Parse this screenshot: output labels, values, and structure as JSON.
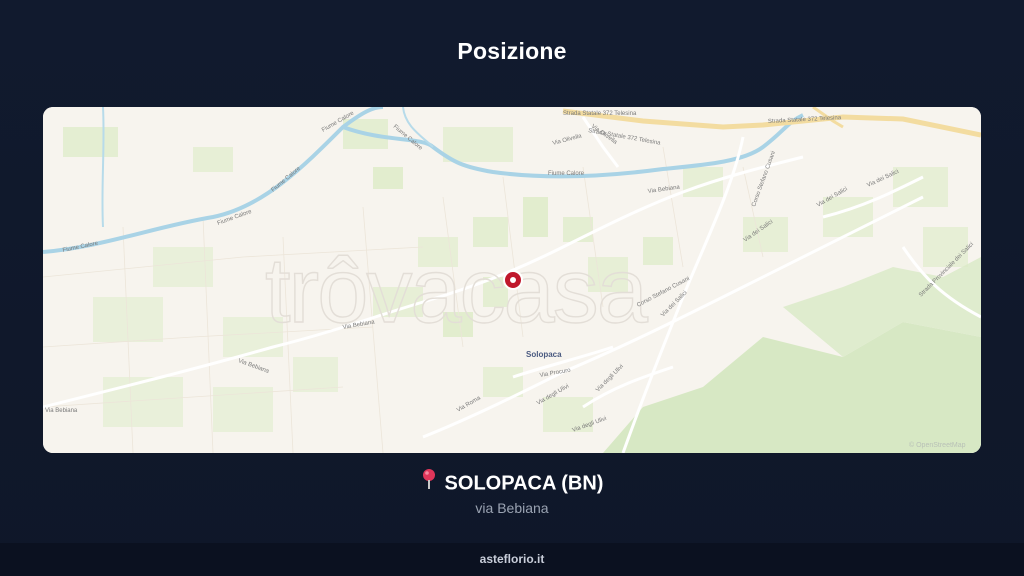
{
  "page": {
    "title": "Posizione"
  },
  "map": {
    "watermark": "trôvacasa",
    "town_label": "Solopaca",
    "attribution": "© OpenStreetMap",
    "marker_icon": "location-marker-icon",
    "road_labels": {
      "via_bebiana_1": "Via Bebiana",
      "via_bebiana_2": "Via Bebiana",
      "via_bebiana_3": "Via Bebiana",
      "via_bebiana_4": "Via Bebiana",
      "via_olivella_1": "Via Olivella",
      "via_olivella_2": "Via Olivella",
      "telesina_1": "Strada Statale 372 Telesina",
      "telesina_2": "Strada Statale 372 Telesina",
      "telesina_3": "Strada Statale 372 Telesina",
      "calore_1": "Fiume Calore",
      "calore_2": "Fiume Calore",
      "calore_3": "Fiume Calore",
      "calore_4": "Fiume Calore",
      "calore_5": "Fiume Calore",
      "calore_6": "Fiume Calore",
      "corso_cusani_1": "Corso Stefano Cusani",
      "corso_cusani_2": "Corso Stefano Cusani",
      "via_salici_1": "Via dei Salici",
      "via_salici_2": "Via dei Salici",
      "via_salici_3": "Via dei Salici",
      "via_salici_4": "Via dei Salici",
      "strada_provinciale": "Strada Provinciale dei Salici",
      "via_roma": "Via Roma",
      "via_degli_ulivi_1": "Via degli Ulivi",
      "via_degli_ulivi_2": "Via degli Ulivi",
      "via_degli_ulivi_3": "Via degli Ulivi",
      "via_procuro": "Via Procuro"
    }
  },
  "location": {
    "pin_icon": "pushpin-icon",
    "city": "SOLOPACA (BN)",
    "street": "via Bebiana"
  },
  "footer": {
    "site": "asteflorio.it"
  },
  "colors": {
    "background": "#111a2e",
    "footer_bg": "#0b1120",
    "map_base": "#f7f4ee",
    "river": "#a9d3e6",
    "green": "#dcebc6",
    "main_road": "#f3dca0",
    "marker": "#c0182c"
  }
}
